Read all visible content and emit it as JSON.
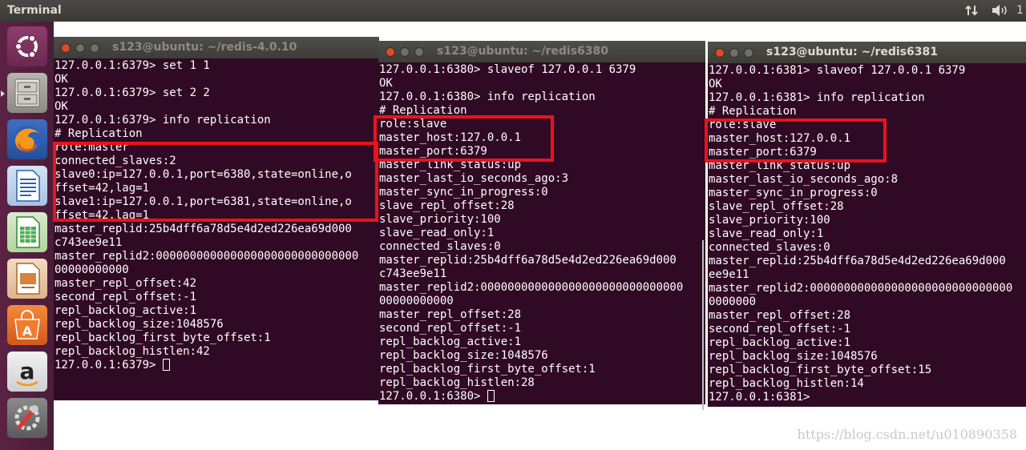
{
  "topbar": {
    "title": "Terminal",
    "clock": "1"
  },
  "launcher": {
    "items": [
      "ubuntu-dash",
      "files",
      "firefox",
      "writer",
      "calc",
      "impress",
      "software-center",
      "amazon",
      "system-settings"
    ]
  },
  "windows": [
    {
      "title": "s123@ubuntu: ~/redis-4.0.10",
      "lines": [
        "127.0.0.1:6379> set 1 1",
        "OK",
        "127.0.0.1:6379> set 2 2",
        "OK",
        "127.0.0.1:6379> info replication",
        "# Replication",
        "role:master",
        "connected_slaves:2",
        "slave0:ip=127.0.0.1,port=6380,state=online,o",
        "ffset=42,lag=1",
        "slave1:ip=127.0.0.1,port=6381,state=online,o",
        "ffset=42,lag=1",
        "master_replid:25b4dff6a78d5e4d2ed226ea69d000",
        "c743ee9e11",
        "master_replid2:000000000000000000000000000000",
        "00000000000",
        "master_repl_offset:42",
        "second_repl_offset:-1",
        "repl_backlog_active:1",
        "repl_backlog_size:1048576",
        "repl_backlog_first_byte_offset:1",
        "repl_backlog_histlen:42"
      ],
      "prompt": "127.0.0.1:6379> "
    },
    {
      "title": "s123@ubuntu: ~/redis6380",
      "lines": [
        "127.0.0.1:6380> slaveof 127.0.0.1 6379",
        "OK",
        "127.0.0.1:6380> info replication",
        "# Replication",
        "role:slave",
        "master_host:127.0.0.1",
        "master_port:6379",
        "master_link_status:up",
        "master_last_io_seconds_ago:3",
        "master_sync_in_progress:0",
        "slave_repl_offset:28",
        "slave_priority:100",
        "slave_read_only:1",
        "connected_slaves:0",
        "master_replid:25b4dff6a78d5e4d2ed226ea69d000",
        "c743ee9e11",
        "master_replid2:000000000000000000000000000000",
        "00000000000",
        "master_repl_offset:28",
        "second_repl_offset:-1",
        "repl_backlog_active:1",
        "repl_backlog_size:1048576",
        "repl_backlog_first_byte_offset:1",
        "repl_backlog_histlen:28"
      ],
      "prompt": "127.0.0.1:6380> "
    },
    {
      "title": "s123@ubuntu: ~/redis6381",
      "lines": [
        "127.0.0.1:6381> slaveof 127.0.0.1 6379",
        "OK",
        "127.0.0.1:6381> info replication",
        "# Replication",
        "role:slave",
        "master_host:127.0.0.1",
        "master_port:6379",
        "master_link_status:up",
        "master_last_io_seconds_ago:8",
        "master_sync_in_progress:0",
        "slave_repl_offset:28",
        "slave_priority:100",
        "slave_read_only:1",
        "connected_slaves:0",
        "master_replid:25b4dff6a78d5e4d2ed226ea69d000",
        "ee9e11",
        "master_replid2:000000000000000000000000000000",
        "0000000",
        "master_repl_offset:28",
        "second_repl_offset:-1",
        "repl_backlog_active:1",
        "repl_backlog_size:1048576",
        "repl_backlog_first_byte_offset:15",
        "repl_backlog_histlen:14"
      ],
      "prompt": "127.0.0.1:6381>"
    }
  ],
  "watermark": "https://blog.csdn.net/u010890358",
  "colors": {
    "terminal_bg": "#300a24",
    "highlight": "#e8131c",
    "launcher_bg": "#5b2243"
  }
}
